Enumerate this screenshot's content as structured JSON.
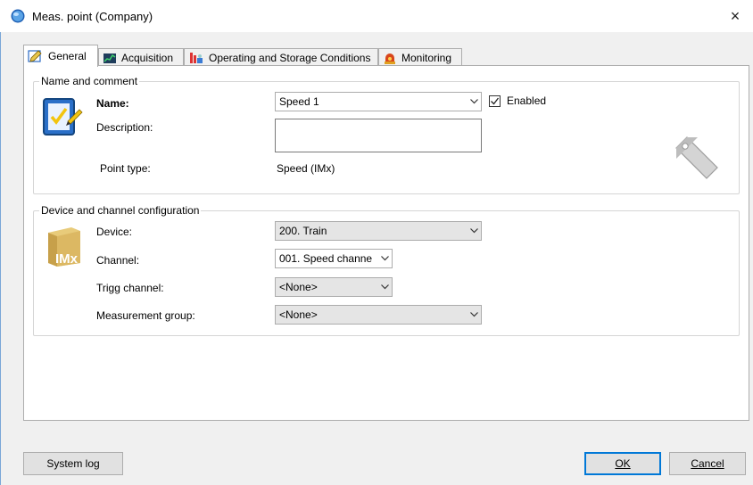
{
  "window": {
    "title": "Meas. point (Company)",
    "close_glyph": "×",
    "app_icon": "blue-globe-icon"
  },
  "tabs": [
    {
      "label": "General",
      "icon": "edit-icon",
      "active": true
    },
    {
      "label": "Acquisition",
      "icon": "acquisition-icon",
      "active": false
    },
    {
      "label": "Operating and Storage Conditions",
      "icon": "conditions-icon",
      "active": false
    },
    {
      "label": "Monitoring",
      "icon": "alarm-icon",
      "active": false
    }
  ],
  "name_group": {
    "title": "Name and comment",
    "name_label": "Name:",
    "name_value": "Speed 1",
    "enabled_label": "Enabled",
    "enabled_checked": true,
    "description_label": "Description:",
    "description_value": "",
    "point_type_label": "Point type:",
    "point_type_value": "Speed (IMx)"
  },
  "device_group": {
    "title": "Device and channel configuration",
    "device_label": "Device:",
    "device_value": "200. Train",
    "channel_label": "Channel:",
    "channel_value": "001. Speed channe",
    "trigg_label": "Trigg channel:",
    "trigg_value": "<None>",
    "group_label": "Measurement group:",
    "group_value": "<None>",
    "imx_logo_text": "IMx"
  },
  "footer": {
    "system_log": "System log",
    "ok": "OK",
    "cancel": "Cancel"
  },
  "colors": {
    "accent": "#0078d7",
    "tab_border": "#adadad",
    "imx_gold": "#d9b45a"
  }
}
